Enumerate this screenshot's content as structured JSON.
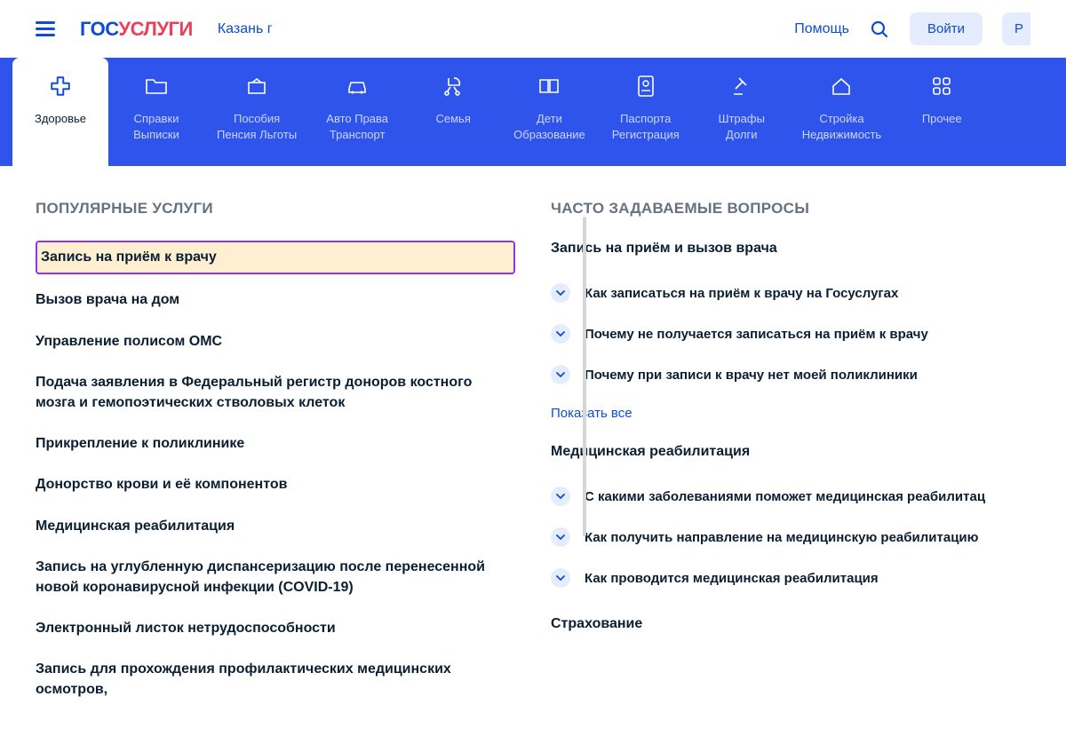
{
  "header": {
    "city": "Казань г",
    "help": "Помощь",
    "login": "Войти",
    "register_prefix": "Р"
  },
  "tabs": [
    {
      "label": "Здоровье"
    },
    {
      "label": "Справки\nВыписки"
    },
    {
      "label": "Пособия\nПенсия Льготы"
    },
    {
      "label": "Авто Права\nТранспорт"
    },
    {
      "label": "Семья"
    },
    {
      "label": "Дети\nОбразование"
    },
    {
      "label": "Паспорта\nРегистрация"
    },
    {
      "label": "Штрафы\nДолги"
    },
    {
      "label": "Стройка\nНедвижимость"
    },
    {
      "label": "Прочее"
    }
  ],
  "popular": {
    "title": "ПОПУЛЯРНЫЕ УСЛУГИ",
    "items": [
      "Запись на приём к врачу",
      "Вызов врача на дом",
      "Управление полисом ОМС",
      "Подача заявления в Федеральный регистр доноров костного мозга и гемопоэтических стволовых клеток",
      "Прикрепление к поликлинике",
      "Донорство крови и её компонентов",
      "Медицинская реабилитация",
      "Запись на углубленную диспансеризацию после перенесенной новой коронавирусной инфекции (COVID-19)",
      "Электронный листок нетрудоспособности",
      "Запись для прохождения профилактических медицинских осмотров,"
    ]
  },
  "faq": {
    "title": "ЧАСТО ЗАДАВАЕМЫЕ ВОПРОСЫ",
    "show_all": "Показать все",
    "groups": [
      {
        "title": "Запись на приём и вызов врача",
        "items": [
          "Как записаться на приём к врачу на Госуслугах",
          "Почему не получается записаться на приём к врачу",
          "Почему при записи к врачу нет моей поликлиники"
        ]
      },
      {
        "title": "Медицинская реабилитация",
        "items": [
          "С какими заболеваниями поможет медицинская реабилитац",
          "Как получить направление на медицинскую реабилитацию",
          "Как проводится медицинская реабилитация"
        ]
      },
      {
        "title": "Страхование",
        "items": []
      }
    ]
  }
}
